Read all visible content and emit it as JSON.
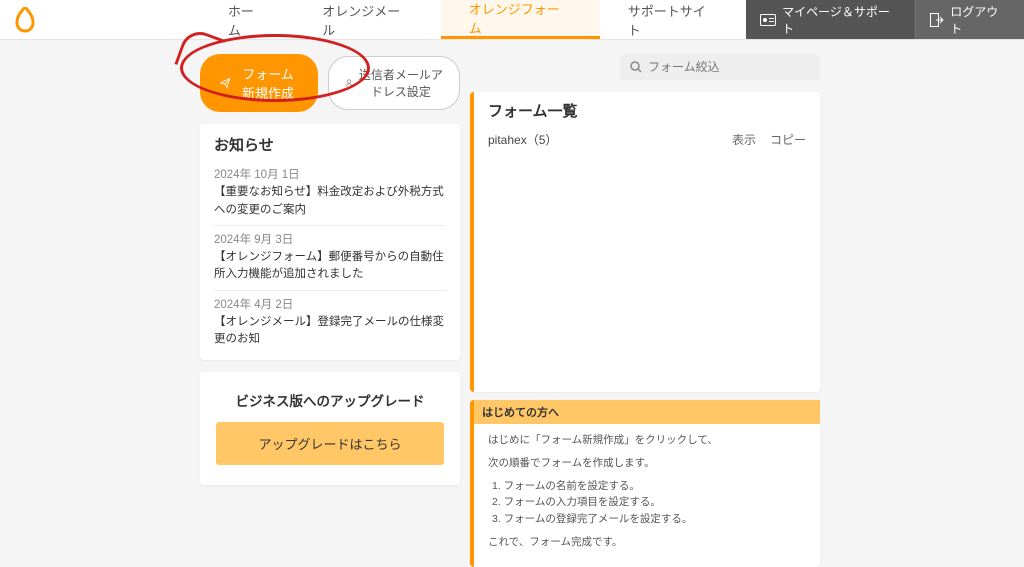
{
  "nav": {
    "tabs": [
      "ホーム",
      "オレンジメール",
      "オレンジフォーム",
      "サポートサイト"
    ],
    "mypage": "マイページ＆サポート",
    "logout": "ログアウト"
  },
  "buttons": {
    "new_form": "フォーム新規作成",
    "sender_settings": "送信者メールアドレス設定"
  },
  "search": {
    "placeholder": "フォーム絞込"
  },
  "news": {
    "title": "お知らせ",
    "items": [
      {
        "date": "2024年 10月 1日",
        "body": "【重要なお知らせ】料金改定および外税方式への変更のご案内"
      },
      {
        "date": "2024年 9月 3日",
        "body": "【オレンジフォーム】郵便番号からの自動住所入力機能が追加されました"
      },
      {
        "date": "2024年 4月 2日",
        "body": "【オレンジメール】登録完了メールの仕様変更のお知"
      }
    ]
  },
  "upgrade": {
    "heading": "ビジネス版へのアップグレード",
    "button": "アップグレードはこちら"
  },
  "forms_panel": {
    "title": "フォーム一覧",
    "rows": [
      {
        "name": "pitahex（5）",
        "view": "表示",
        "copy": "コピー"
      }
    ]
  },
  "help": {
    "titlebar": "はじめての方へ",
    "intro1": "はじめに「フォーム新規作成」をクリックして、",
    "intro2": "次の順番でフォームを作成します。",
    "steps": [
      "1. フォームの名前を設定する。",
      "2. フォームの入力項目を設定する。",
      "3. フォームの登録完了メールを設定する。"
    ],
    "outro": "これで、フォーム完成です。"
  }
}
